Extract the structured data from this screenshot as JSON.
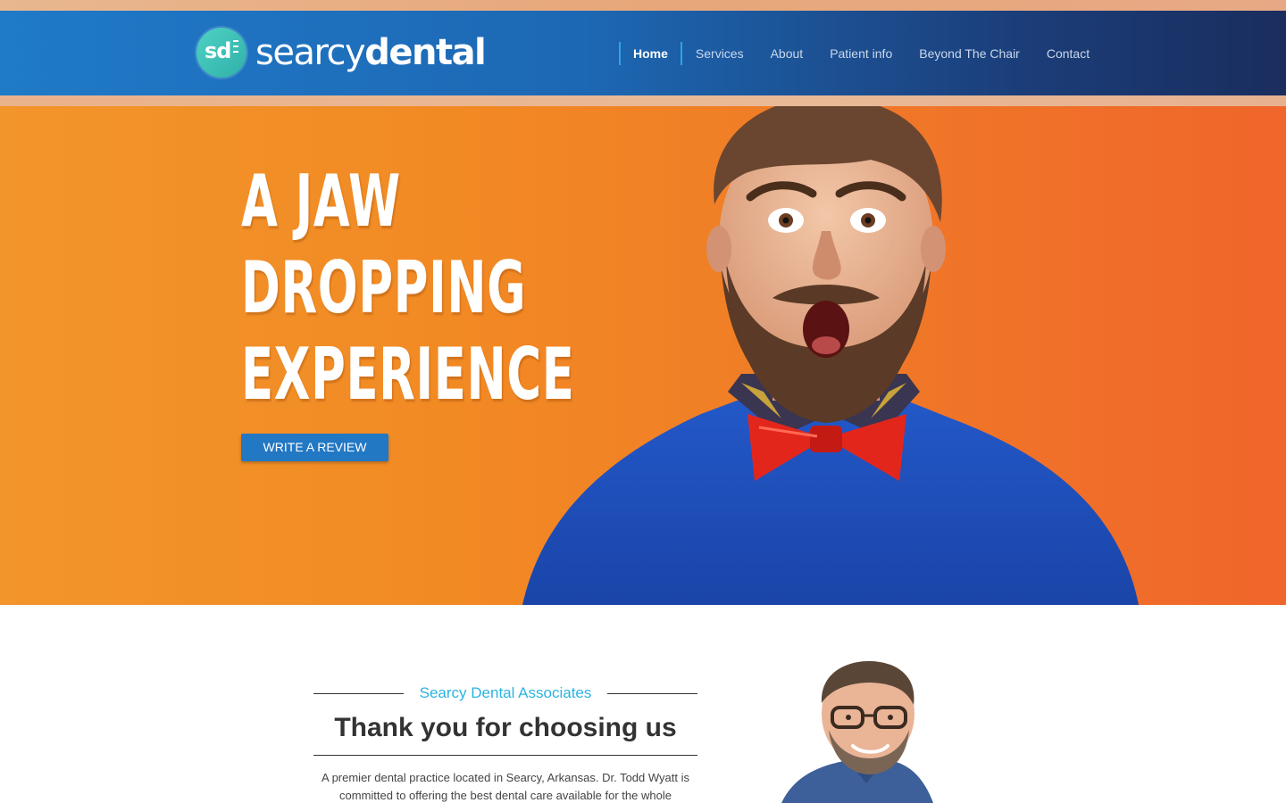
{
  "header": {
    "logo": {
      "badge_text": "sd",
      "word_light": "searcy",
      "word_bold": "dental"
    },
    "nav": [
      {
        "label": "Home",
        "active": true
      },
      {
        "label": "Services"
      },
      {
        "label": "About"
      },
      {
        "label": "Patient info"
      },
      {
        "label": "Beyond The Chair"
      },
      {
        "label": "Contact"
      }
    ]
  },
  "hero": {
    "headline_lines": [
      "A JAW",
      "DROPPING",
      "EXPERIENCE"
    ],
    "cta_label": "WRITE A REVIEW"
  },
  "intro": {
    "subtitle": "Searcy Dental Associates",
    "title": "Thank you for choosing us",
    "text": "A premier dental practice located in Searcy, Arkansas. Dr. Todd Wyatt is committed to offering the best dental care available for the whole"
  },
  "colors": {
    "header_start": "#1f7ac8",
    "header_end": "#1a2d5e",
    "hero_orange": "#f28a24",
    "accent_blue": "#2378c4",
    "subtitle_cyan": "#2bb3e0",
    "logo_teal": "#3fc3b8"
  }
}
